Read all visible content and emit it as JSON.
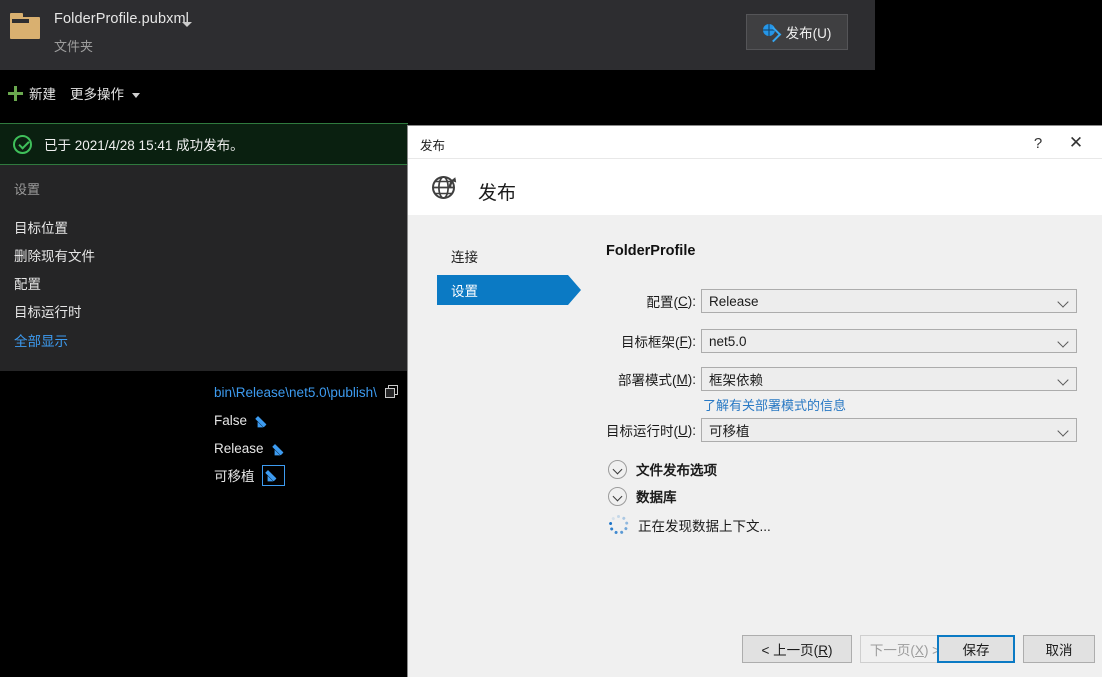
{
  "shell": {
    "profile_name": "FolderProfile.pubxml",
    "profile_subtitle": "文件夹",
    "publish_button": "发布(U)",
    "toolbar": {
      "new_label": "新建",
      "more_label": "更多操作"
    },
    "success_banner": "已于 2021/4/28 15:41 成功发布。",
    "settings": {
      "title": "设置",
      "rows": [
        {
          "key": "目标位置",
          "value": "bin\\Release\\net5.0\\publish\\",
          "kind": "link"
        },
        {
          "key": "删除现有文件",
          "value": "False",
          "kind": "text"
        },
        {
          "key": "配置",
          "value": "Release",
          "kind": "text"
        },
        {
          "key": "目标运行时",
          "value": "可移植",
          "kind": "text"
        }
      ],
      "show_all": "全部显示"
    }
  },
  "dialog": {
    "titlebar_title": "发布",
    "help_glyph": "?",
    "close_glyph": "✕",
    "header_title": "发布",
    "nav": [
      {
        "label": "连接",
        "active": false
      },
      {
        "label": "设置",
        "active": true
      }
    ],
    "profile_heading": "FolderProfile",
    "fields": [
      {
        "label_pre": "配置(",
        "label_key": "C",
        "label_post": "):",
        "value": "Release"
      },
      {
        "label_pre": "目标框架(",
        "label_key": "F",
        "label_post": "):",
        "value": "net5.0"
      },
      {
        "label_pre": "部署模式(",
        "label_key": "M",
        "label_post": "):",
        "value": "框架依赖"
      },
      {
        "label_pre": "目标运行时(",
        "label_key": "U",
        "label_post": "):",
        "value": "可移植"
      }
    ],
    "learn_link": "了解有关部署模式的信息",
    "expanders": [
      {
        "label": "文件发布选项"
      },
      {
        "label": "数据库"
      }
    ],
    "loading_text": "正在发现数据上下文...",
    "buttons": {
      "prev_pre": "< 上一页(",
      "prev_key": "R",
      "prev_post": ")",
      "next_pre": "下一页(",
      "next_key": "X",
      "next_post": ") >",
      "save": "保存",
      "cancel": "取消"
    }
  },
  "colors": {
    "accent_blue": "#0b7ac4",
    "link_blue": "#3d9bf0",
    "success_green": "#3fbf5a",
    "dark_chrome": "#2d2d30",
    "panel": "#252526",
    "dialog_bg": "#f0f0f0"
  }
}
